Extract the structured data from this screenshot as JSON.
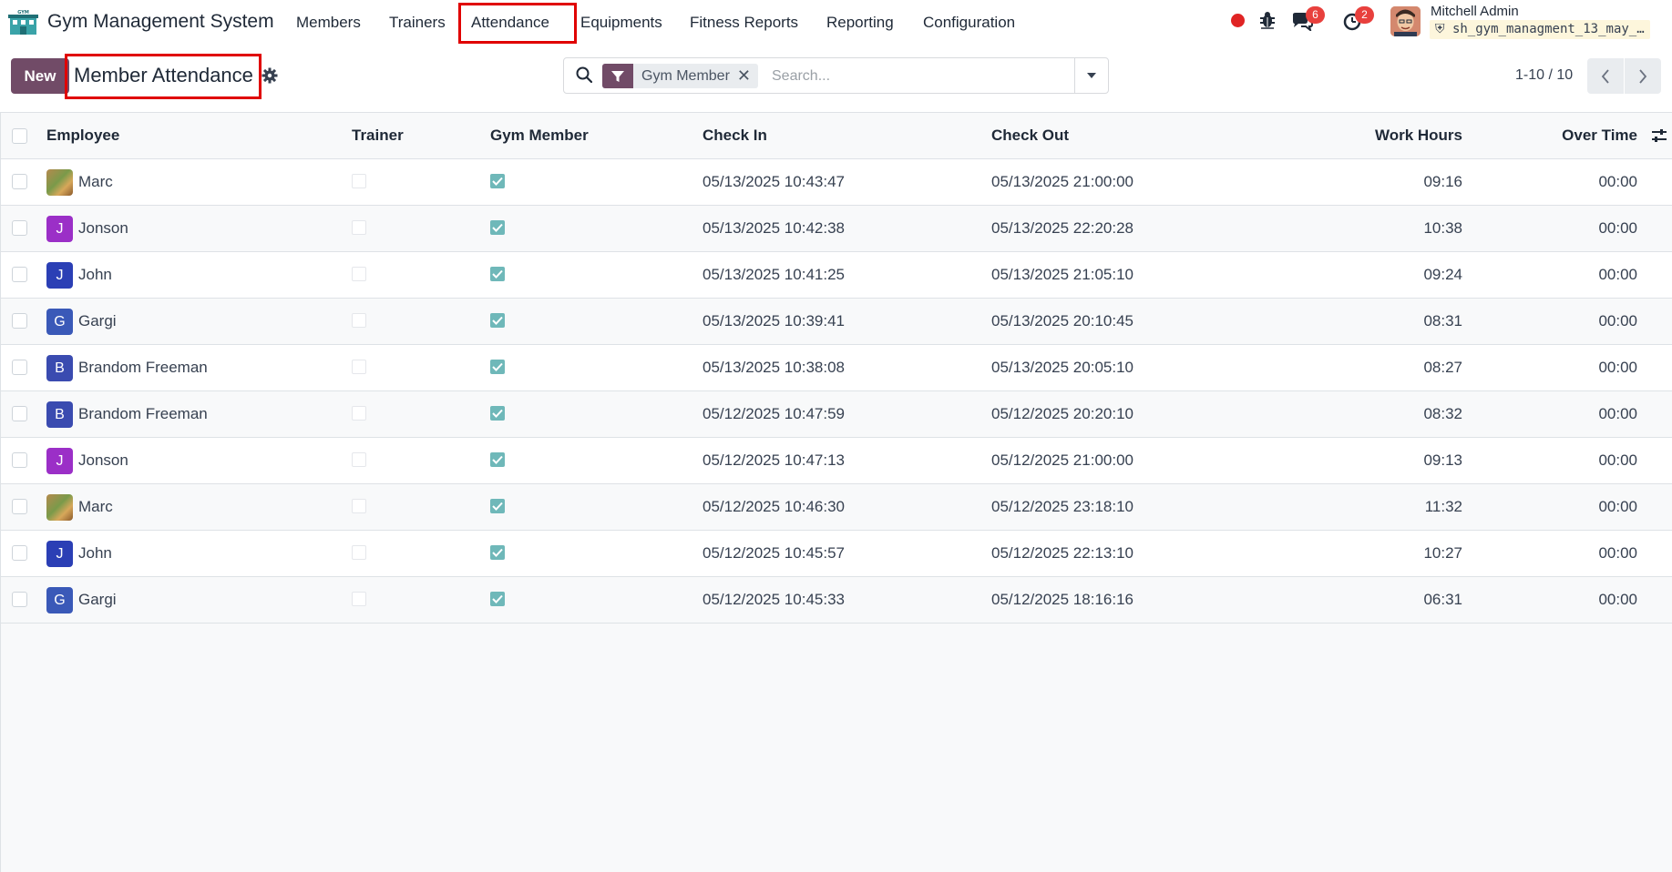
{
  "app": {
    "title": "Gym Management System",
    "menu": [
      "Members",
      "Trainers",
      "Attendance",
      "Equipments",
      "Fitness Reports",
      "Reporting",
      "Configuration"
    ],
    "active_menu": "Attendance"
  },
  "systray": {
    "messages_count": "6",
    "activities_count": "2",
    "user_name": "Mitchell Admin",
    "database": "sh_gym_managment_13_may_…"
  },
  "control_panel": {
    "new_label": "New",
    "page_title": "Member Attendance",
    "filter_facet": "Gym Member",
    "search_placeholder": "Search...",
    "pager_value": "1-10 / 10"
  },
  "table": {
    "columns": {
      "employee": "Employee",
      "trainer": "Trainer",
      "gym_member": "Gym Member",
      "check_in": "Check In",
      "check_out": "Check Out",
      "work_hours": "Work Hours",
      "over_time": "Over Time"
    },
    "rows": [
      {
        "employee": "Marc",
        "initial": "",
        "avatar_color": "photo",
        "trainer": false,
        "gym_member": true,
        "check_in": "05/13/2025 10:43:47",
        "check_out": "05/13/2025 21:00:00",
        "work_hours": "09:16",
        "over_time": "00:00"
      },
      {
        "employee": "Jonson",
        "initial": "J",
        "avatar_color": "#9b2fc7",
        "trainer": false,
        "gym_member": true,
        "check_in": "05/13/2025 10:42:38",
        "check_out": "05/13/2025 22:20:28",
        "work_hours": "10:38",
        "over_time": "00:00"
      },
      {
        "employee": "John",
        "initial": "J",
        "avatar_color": "#2b3fb5",
        "trainer": false,
        "gym_member": true,
        "check_in": "05/13/2025 10:41:25",
        "check_out": "05/13/2025 21:05:10",
        "work_hours": "09:24",
        "over_time": "00:00"
      },
      {
        "employee": "Gargi",
        "initial": "G",
        "avatar_color": "#3a59b8",
        "trainer": false,
        "gym_member": true,
        "check_in": "05/13/2025 10:39:41",
        "check_out": "05/13/2025 20:10:45",
        "work_hours": "08:31",
        "over_time": "00:00"
      },
      {
        "employee": "Brandom Freeman",
        "initial": "B",
        "avatar_color": "#3a4bb0",
        "trainer": false,
        "gym_member": true,
        "check_in": "05/13/2025 10:38:08",
        "check_out": "05/13/2025 20:05:10",
        "work_hours": "08:27",
        "over_time": "00:00"
      },
      {
        "employee": "Brandom Freeman",
        "initial": "B",
        "avatar_color": "#3a4bb0",
        "trainer": false,
        "gym_member": true,
        "check_in": "05/12/2025 10:47:59",
        "check_out": "05/12/2025 20:20:10",
        "work_hours": "08:32",
        "over_time": "00:00"
      },
      {
        "employee": "Jonson",
        "initial": "J",
        "avatar_color": "#9b2fc7",
        "trainer": false,
        "gym_member": true,
        "check_in": "05/12/2025 10:47:13",
        "check_out": "05/12/2025 21:00:00",
        "work_hours": "09:13",
        "over_time": "00:00"
      },
      {
        "employee": "Marc",
        "initial": "",
        "avatar_color": "photo",
        "trainer": false,
        "gym_member": true,
        "check_in": "05/12/2025 10:46:30",
        "check_out": "05/12/2025 23:18:10",
        "work_hours": "11:32",
        "over_time": "00:00"
      },
      {
        "employee": "John",
        "initial": "J",
        "avatar_color": "#2b3fb5",
        "trainer": false,
        "gym_member": true,
        "check_in": "05/12/2025 10:45:57",
        "check_out": "05/12/2025 22:13:10",
        "work_hours": "10:27",
        "over_time": "00:00"
      },
      {
        "employee": "Gargi",
        "initial": "G",
        "avatar_color": "#3a59b8",
        "trainer": false,
        "gym_member": true,
        "check_in": "05/12/2025 10:45:33",
        "check_out": "05/12/2025 18:16:16",
        "work_hours": "06:31",
        "over_time": "00:00"
      }
    ]
  },
  "colors": {
    "brand": "#714b67",
    "highlight_box": "#e00000",
    "checkbox_checked": "#6fb8b9",
    "badge": "#e8403d"
  }
}
